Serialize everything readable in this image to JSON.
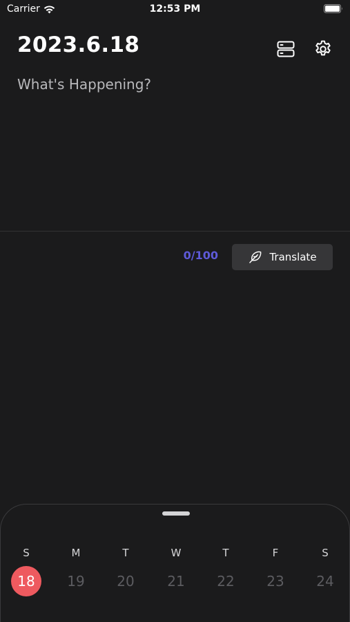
{
  "status_bar": {
    "carrier": "Carrier",
    "time": "12:53 PM"
  },
  "header": {
    "date": "2023.6.18",
    "list_icon": "list-icon",
    "settings_icon": "gear-icon"
  },
  "editor": {
    "placeholder": "What's Happening?",
    "value": ""
  },
  "counter": {
    "text": "0/100"
  },
  "translate": {
    "label": "Translate",
    "icon": "feather-icon"
  },
  "calendar": {
    "days": [
      {
        "letter": "S",
        "number": "18",
        "selected": true
      },
      {
        "letter": "M",
        "number": "19",
        "selected": false
      },
      {
        "letter": "T",
        "number": "20",
        "selected": false
      },
      {
        "letter": "W",
        "number": "21",
        "selected": false
      },
      {
        "letter": "T",
        "number": "22",
        "selected": false
      },
      {
        "letter": "F",
        "number": "23",
        "selected": false
      },
      {
        "letter": "S",
        "number": "24",
        "selected": false
      }
    ]
  },
  "colors": {
    "background": "#1b1b1c",
    "accent": "#5e5ad8",
    "selected_day": "#ee5a5f",
    "button": "#363638"
  }
}
